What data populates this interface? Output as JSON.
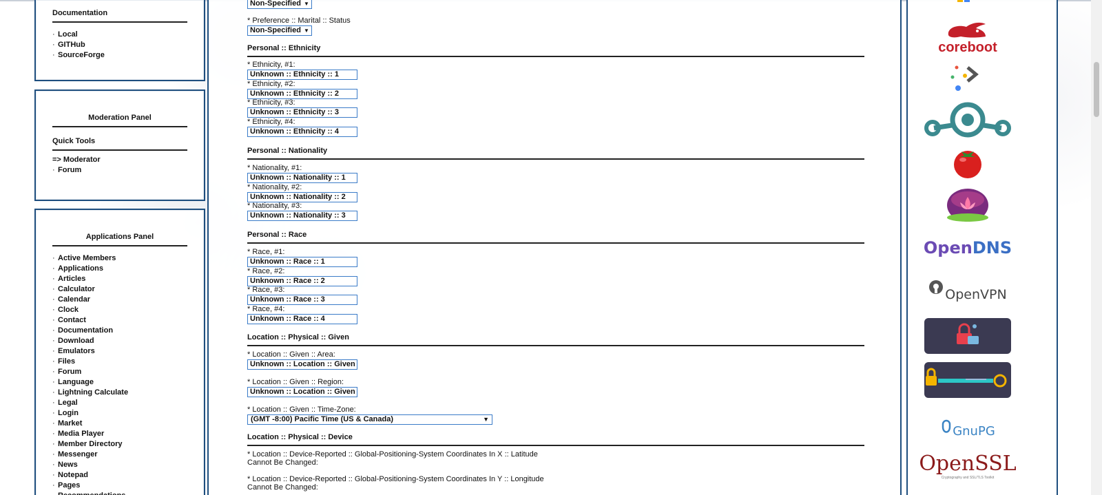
{
  "left": {
    "documentation": {
      "title": "Documentation",
      "items": [
        "Local",
        "GITHub",
        "SourceForge"
      ]
    },
    "moderation": {
      "title": "Moderation Panel",
      "quick_tools": "Quick Tools",
      "moderator": "=> Moderator",
      "items": [
        "Forum"
      ]
    },
    "applications": {
      "title": "Applications Panel",
      "items": [
        "Active Members",
        "Applications",
        "Articles",
        "Calculator",
        "Calendar",
        "Clock",
        "Contact",
        "Documentation",
        "Download",
        "Emulators",
        "Files",
        "Forum",
        "Language",
        "Lightning Calculate",
        "Legal",
        "Login",
        "Market",
        "Media Player",
        "Member Directory",
        "Messenger",
        "News",
        "Notepad",
        "Pages",
        "Recommendations"
      ]
    }
  },
  "form": {
    "top_select": "Non-Specified",
    "marital_label": "* Preference :: Marital :: Status",
    "marital_select": "Non-Specified",
    "ethnicity": {
      "title": "Personal :: Ethnicity",
      "fields": [
        {
          "label": "* Ethnicity, #1:",
          "value": "Unknown :: Ethnicity :: 1"
        },
        {
          "label": "* Ethnicity, #2:",
          "value": "Unknown :: Ethnicity :: 2"
        },
        {
          "label": "* Ethnicity, #3:",
          "value": "Unknown :: Ethnicity :: 3"
        },
        {
          "label": "* Ethnicity, #4:",
          "value": "Unknown :: Ethnicity :: 4"
        }
      ]
    },
    "nationality": {
      "title": "Personal :: Nationality",
      "fields": [
        {
          "label": "* Nationality, #1:",
          "value": "Unknown :: Nationality :: 1"
        },
        {
          "label": "* Nationality, #2:",
          "value": "Unknown :: Nationality :: 2"
        },
        {
          "label": "* Nationality, #3:",
          "value": "Unknown :: Nationality :: 3"
        }
      ]
    },
    "race": {
      "title": "Personal :: Race",
      "fields": [
        {
          "label": "* Race, #1:",
          "value": "Unknown :: Race :: 1"
        },
        {
          "label": "* Race, #2:",
          "value": "Unknown :: Race :: 2"
        },
        {
          "label": "* Race, #3:",
          "value": "Unknown :: Race :: 3"
        },
        {
          "label": "* Race, #4:",
          "value": "Unknown :: Race :: 4"
        }
      ]
    },
    "location_given": {
      "title": "Location :: Physical :: Given",
      "area_label": "* Location :: Given :: Area:",
      "area_value": "Unknown :: Location :: Given",
      "region_label": "* Location :: Given :: Region:",
      "region_value": "Unknown :: Location :: Given",
      "tz_label": "* Location :: Given :: Time-Zone:",
      "tz_value": "(GMT -8:00) Pacific Time (US & Canada)"
    },
    "location_device": {
      "title": "Location :: Physical :: Device",
      "lat_label": "* Location :: Device-Reported :: Global-Positioning-System Coordinates In X :: Latitude",
      "lat_note": "Cannot Be Changed:",
      "lon_label": "* Location :: Device-Reported :: Global-Positioning-System Coordinates In Y :: Longitude",
      "lon_note": "Cannot Be Changed:"
    }
  },
  "sponsors": {
    "coreboot": "coreboot",
    "opendns_a": "Open",
    "opendns_b": "DNS",
    "openvpn": "OpenVPN",
    "gnupg": "GnuPG",
    "openssl": "OpenSSL",
    "openssl_tag": "Cryptography and SSL/TLS Toolkit"
  },
  "colors": {
    "border": "#1e4e7e",
    "input_border": "#3a7bc8",
    "opendns_purple": "#6b4bb4",
    "opendns_blue": "#3b6fc4",
    "coreboot_red": "#c4202a",
    "openssl_red": "#8b1a1a"
  }
}
